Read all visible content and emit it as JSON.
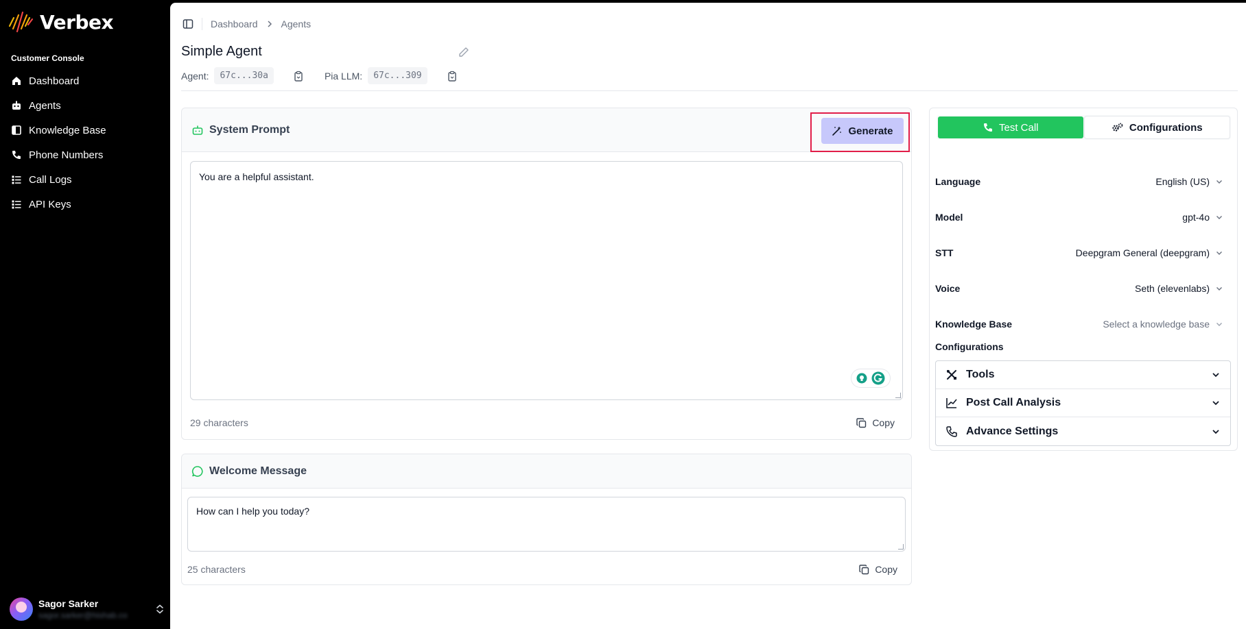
{
  "brand": {
    "name": "Verbex",
    "logo_colors": [
      "#f59e0b",
      "#ef4444",
      "#eab308"
    ]
  },
  "sidebar": {
    "section_label": "Customer Console",
    "items": [
      {
        "label": "Dashboard",
        "icon": "home-icon"
      },
      {
        "label": "Agents",
        "icon": "bot-icon"
      },
      {
        "label": "Knowledge Base",
        "icon": "book-icon"
      },
      {
        "label": "Phone Numbers",
        "icon": "phone-icon"
      },
      {
        "label": "Call Logs",
        "icon": "list-icon"
      },
      {
        "label": "API Keys",
        "icon": "list-icon"
      }
    ],
    "user": {
      "name": "Sagor Sarker",
      "email": "sagor.sarker@hishab.co"
    }
  },
  "breadcrumb": [
    "Dashboard",
    "Agents"
  ],
  "agent": {
    "title": "Simple Agent",
    "agent_label": "Agent:",
    "agent_id": "67c...30a",
    "llm_label": "Pia LLM:",
    "llm_id": "67c...309"
  },
  "system_prompt": {
    "title": "System Prompt",
    "generate_label": "Generate",
    "text": "You are a helpful assistant.",
    "char_count": "29 characters",
    "copy_label": "Copy"
  },
  "welcome_message": {
    "title": "Welcome Message",
    "text": "How can I help you today?",
    "char_count": "25 characters",
    "copy_label": "Copy"
  },
  "right_panel": {
    "tabs": [
      {
        "label": "Test Call",
        "active": true
      },
      {
        "label": "Configurations",
        "active": false
      }
    ],
    "fields": [
      {
        "label": "Language",
        "value": "English (US)"
      },
      {
        "label": "Model",
        "value": "gpt-4o"
      },
      {
        "label": "STT",
        "value": "Deepgram General (deepgram)"
      },
      {
        "label": "Voice",
        "value": "Seth (elevenlabs)"
      },
      {
        "label": "Knowledge Base",
        "value": "Select a knowledge base"
      }
    ],
    "configurations_label": "Configurations",
    "accordion": [
      "Tools",
      "Post Call Analysis",
      "Advance Settings"
    ]
  },
  "colors": {
    "accent_green": "#22c55e",
    "generate_bg": "#c7c8fb",
    "highlight": "#e11d48"
  }
}
